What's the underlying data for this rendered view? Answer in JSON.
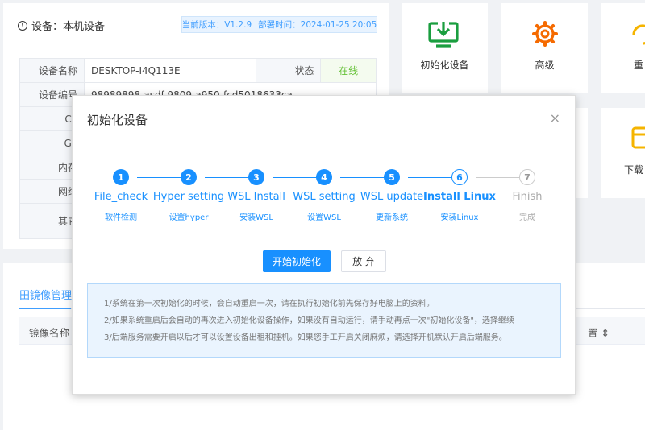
{
  "device": {
    "header": "设备：本机设备",
    "version_label": "当前版本：V1.2.9",
    "deploy_label": "部署时间：2024-01-25 20:05",
    "rows": [
      {
        "label": "设备名称",
        "value": "DESKTOP-I4Q113E",
        "status_label": "状态",
        "status_value": "在线"
      },
      {
        "label": "设备编号",
        "value": "98989898-asdf-9809-a950-fcd5018633ca"
      },
      {
        "label": "CP",
        "value": ""
      },
      {
        "label": "GP",
        "value": ""
      },
      {
        "label": "内存",
        "value": ""
      },
      {
        "label": "网络",
        "value": ""
      },
      {
        "label": "其它",
        "value": ""
      }
    ]
  },
  "tiles": {
    "init_label": "初始化设备",
    "advanced_label": "高级",
    "restart_label": "重",
    "download_label": "下载"
  },
  "colors": {
    "primary": "#1890ff",
    "green_icon": "#1a9e3f",
    "orange_icon": "#f56a00",
    "yellow_icon": "#f5b400",
    "online": "#67c23a"
  },
  "mirror": {
    "tab_label": "田镜像管理",
    "col_name": "镜像名称",
    "col_right": "置 ⇕"
  },
  "dialog": {
    "title": "初始化设备",
    "close": "×",
    "steps": [
      {
        "num": "1",
        "title": "File_check",
        "desc": "软件检测",
        "state": "done"
      },
      {
        "num": "2",
        "title": "Hyper setting",
        "desc": "设置hyper",
        "state": "done"
      },
      {
        "num": "3",
        "title": "WSL Install",
        "desc": "安装WSL",
        "state": "done"
      },
      {
        "num": "4",
        "title": "WSL setting",
        "desc": "设置WSL",
        "state": "done"
      },
      {
        "num": "5",
        "title": "WSL update",
        "desc": "更新系统",
        "state": "done"
      },
      {
        "num": "6",
        "title": "Install Linux",
        "desc": "安装Linux",
        "state": "current"
      },
      {
        "num": "7",
        "title": "Finish",
        "desc": "完成",
        "state": "wait"
      }
    ],
    "start_button": "开始初始化",
    "abandon_button": "放 弃",
    "notes": [
      "1/系统在第一次初始化的时候，会自动重启一次，请在执行初始化前先保存好电脑上的资料。",
      "2/如果系统重启后会自动的再次进入初始化设备操作，如果没有自动运行，请手动再点一次\"初始化设备\"，选择继续",
      "3/后端服务需要开启以后才可以设置设备出租和挂机。如果您手工开启关闭麻烦，请选择开机默认开启后端服务。"
    ]
  }
}
